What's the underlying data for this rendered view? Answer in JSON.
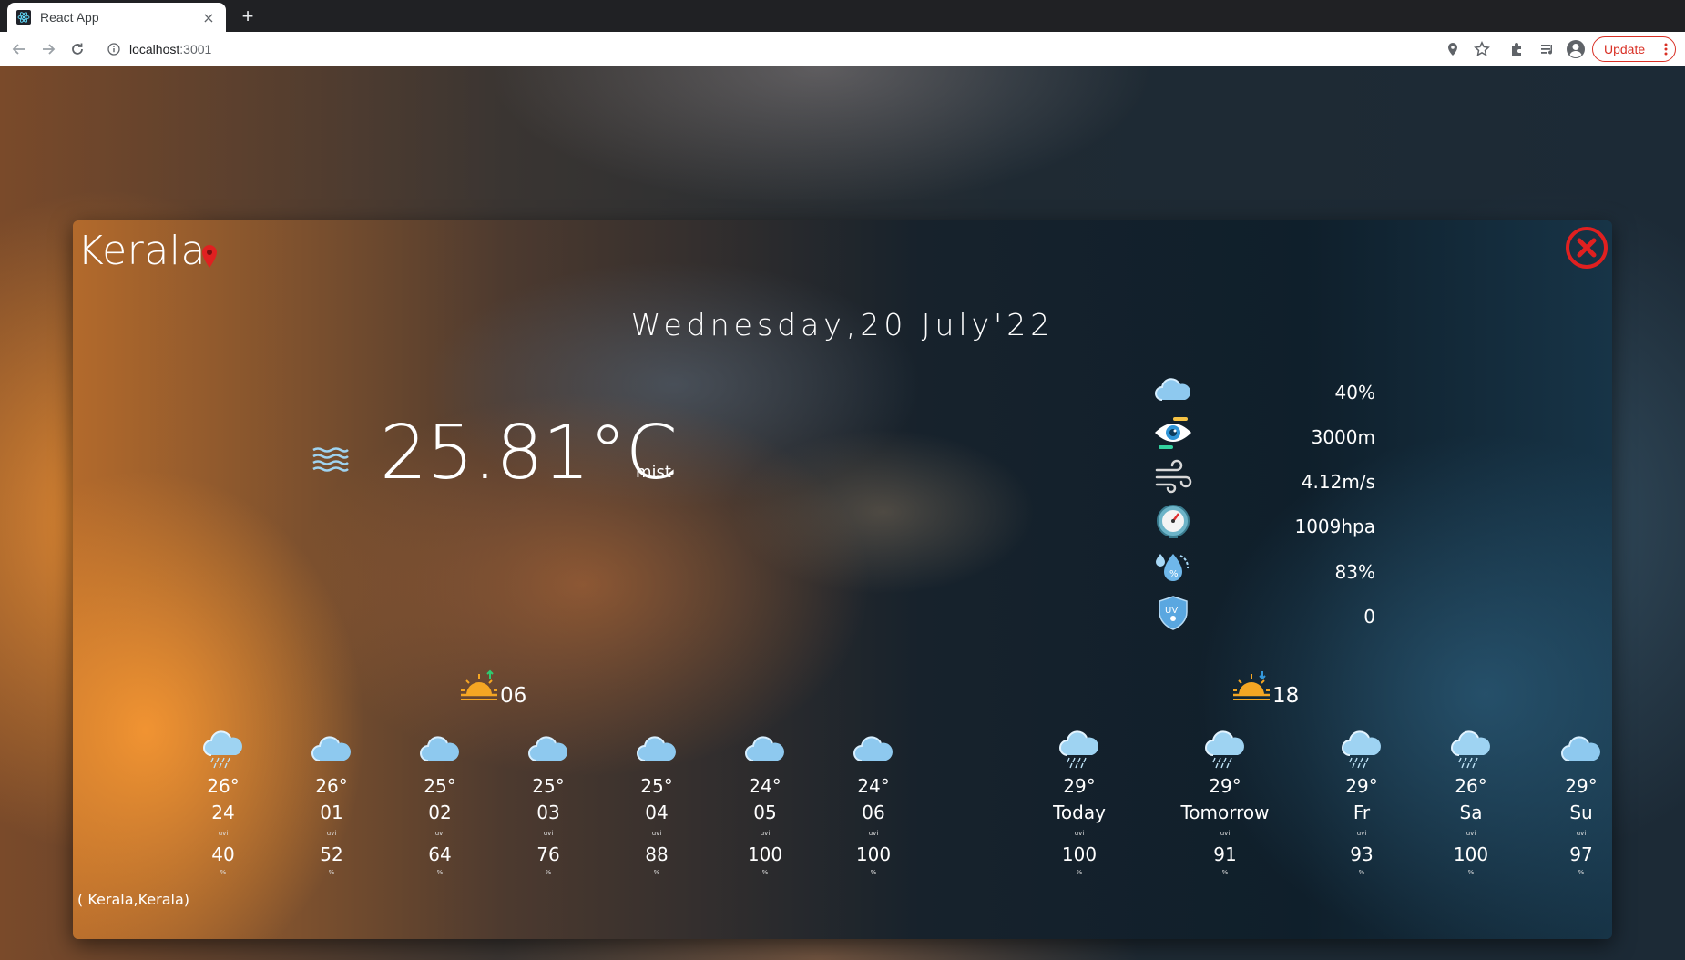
{
  "browser": {
    "tab_title": "React App",
    "tab_close": "×",
    "new_tab": "+",
    "url_host": "localhost",
    "url_port": ":3001",
    "update_label": "Update"
  },
  "weather": {
    "city": "Kerala",
    "date": "Wednesday,20 July'22",
    "temperature": "25.81°C",
    "condition": "mist",
    "stats": {
      "clouds": "40%",
      "visibility": "3000m",
      "wind": "4.12m/s",
      "pressure": "1009hpa",
      "humidity": "83%",
      "uv_index": "0"
    },
    "sunrise": "06",
    "sunset": "18",
    "hourly": [
      {
        "temp": "26°",
        "label": "24",
        "uvi": "uvi",
        "pct": "40",
        "pct_sym": "%",
        "icon": "rain-cloud-icon"
      },
      {
        "temp": "26°",
        "label": "01",
        "uvi": "uvi",
        "pct": "52",
        "pct_sym": "%",
        "icon": "cloud-icon"
      },
      {
        "temp": "25°",
        "label": "02",
        "uvi": "uvi",
        "pct": "64",
        "pct_sym": "%",
        "icon": "cloud-icon"
      },
      {
        "temp": "25°",
        "label": "03",
        "uvi": "uvi",
        "pct": "76",
        "pct_sym": "%",
        "icon": "cloud-icon"
      },
      {
        "temp": "25°",
        "label": "04",
        "uvi": "uvi",
        "pct": "88",
        "pct_sym": "%",
        "icon": "cloud-icon"
      },
      {
        "temp": "24°",
        "label": "05",
        "uvi": "uvi",
        "pct": "100",
        "pct_sym": "%",
        "icon": "cloud-icon"
      },
      {
        "temp": "24°",
        "label": "06",
        "uvi": "uvi",
        "pct": "100",
        "pct_sym": "%",
        "icon": "cloud-icon"
      }
    ],
    "daily": [
      {
        "temp": "29°",
        "label": "Today",
        "uvi": "uvi",
        "pct": "100",
        "pct_sym": "%",
        "icon": "rain-cloud-icon"
      },
      {
        "temp": "29°",
        "label": "Tomorrow",
        "uvi": "uvi",
        "pct": "91",
        "pct_sym": "%",
        "icon": "rain-cloud-icon"
      },
      {
        "temp": "29°",
        "label": "Fr",
        "uvi": "uvi",
        "pct": "93",
        "pct_sym": "%",
        "icon": "rain-cloud-icon"
      },
      {
        "temp": "26°",
        "label": "Sa",
        "uvi": "uvi",
        "pct": "100",
        "pct_sym": "%",
        "icon": "rain-cloud-icon"
      },
      {
        "temp": "29°",
        "label": "Su",
        "uvi": "uvi",
        "pct": "97",
        "pct_sym": "%",
        "icon": "cloud-icon"
      }
    ],
    "location_note": "( Kerala,Kerala)"
  },
  "colors": {
    "accent_red": "#e02020",
    "cloud_blue": "#8ec9ef"
  }
}
